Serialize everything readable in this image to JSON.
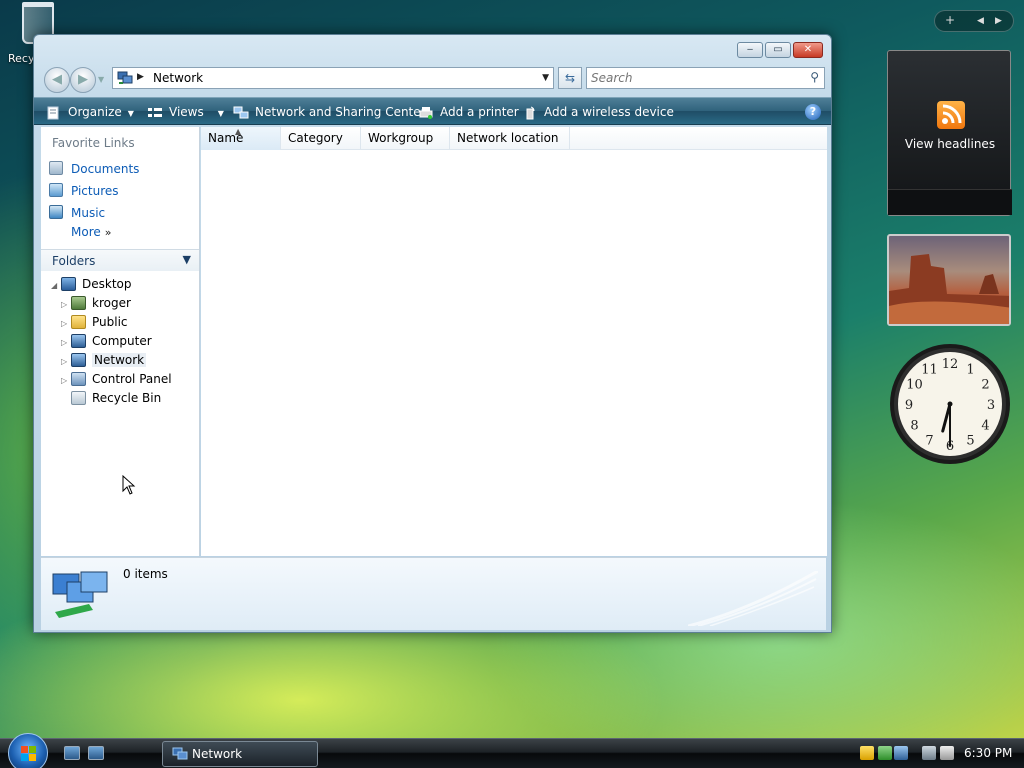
{
  "desktop": {
    "recycle_label": "Recy"
  },
  "window": {
    "controls": {
      "minimize": "‒",
      "maximize": "▭",
      "close": "✕"
    }
  },
  "address": {
    "path": "Network",
    "search_placeholder": "Search"
  },
  "commandbar": {
    "organize": "Organize",
    "views": "Views",
    "sharing_center": "Network and Sharing Center",
    "add_printer": "Add a printer",
    "add_wireless": "Add a wireless device",
    "help": "?"
  },
  "nav": {
    "favorite_links_title": "Favorite Links",
    "favorites": [
      "Documents",
      "Pictures",
      "Music"
    ],
    "more": "More",
    "folders_title": "Folders",
    "tree": [
      "Desktop",
      "kroger",
      "Public",
      "Computer",
      "Network",
      "Control Panel",
      "Recycle Bin"
    ]
  },
  "columns": [
    "Name",
    "Category",
    "Workgroup",
    "Network location"
  ],
  "details": {
    "item_count": "0 items"
  },
  "gadgets": {
    "feed_label": "View headlines",
    "sidebar_add": "+"
  },
  "clock": {
    "numbers": [
      "12",
      "1",
      "2",
      "3",
      "4",
      "5",
      "6",
      "7",
      "8",
      "9",
      "10",
      "11"
    ],
    "hour": 6,
    "minute": 30
  },
  "taskbar": {
    "task_label": "Network",
    "time": "6:30 PM"
  },
  "colors": {
    "link": "#0d5cb6",
    "commandbar": "#2f627c"
  }
}
